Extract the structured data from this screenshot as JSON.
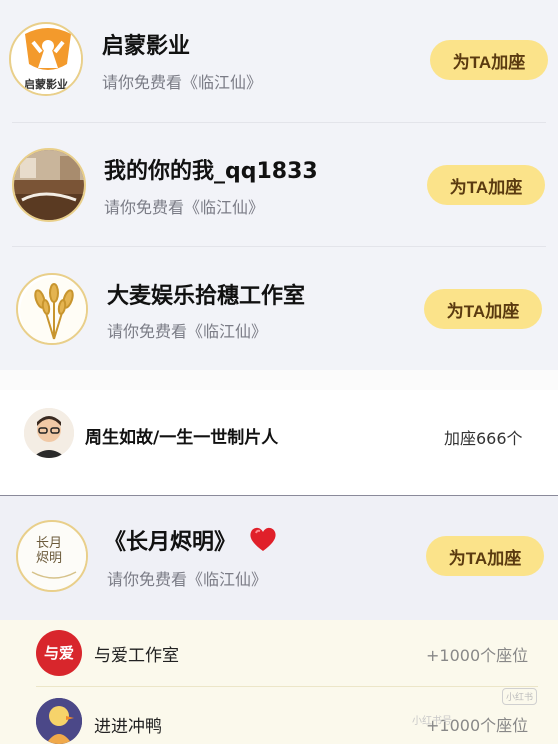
{
  "rows": [
    {
      "name": "启蒙影业",
      "subtitle": "请你免费看《临江仙》",
      "button": "为TA加座",
      "avatar_icon": "qimeng-logo-icon",
      "avatar_text": "启蒙影业"
    },
    {
      "name": "我的你的我_qq1833",
      "subtitle": "请你免费看《临江仙》",
      "button": "为TA加座",
      "avatar_icon": "user-photo-icon"
    },
    {
      "name": "大麦娱乐拾穗工作室",
      "subtitle": "请你免费看《临江仙》",
      "button": "为TA加座",
      "avatar_icon": "wheat-icon"
    }
  ],
  "sponsor": {
    "name": "周生如故/一生一世制片人",
    "count": "加座666个",
    "avatar_icon": "producer-avatar-icon"
  },
  "row4": {
    "name": "《长月烬明》",
    "subtitle": "请你免费看《临江仙》",
    "button": "为TA加座",
    "avatar_icon": "changyue-logo-icon",
    "avatar_text": "长月烬明",
    "heart_icon": "heart-icon"
  },
  "cream": [
    {
      "name": "与爱工作室",
      "count": "+1000个座位",
      "avatar_icon": "yuai-logo-icon",
      "avatar_text": "与爱"
    },
    {
      "name": "进进冲鸭",
      "count": "+1000个座位",
      "avatar_icon": "duck-avatar-icon"
    }
  ],
  "watermark": {
    "badge": "小红书",
    "text": "小红书号"
  },
  "colors": {
    "button_bg": "#fbe38a",
    "button_text": "#5a3a10",
    "heart": "#e0202a"
  }
}
